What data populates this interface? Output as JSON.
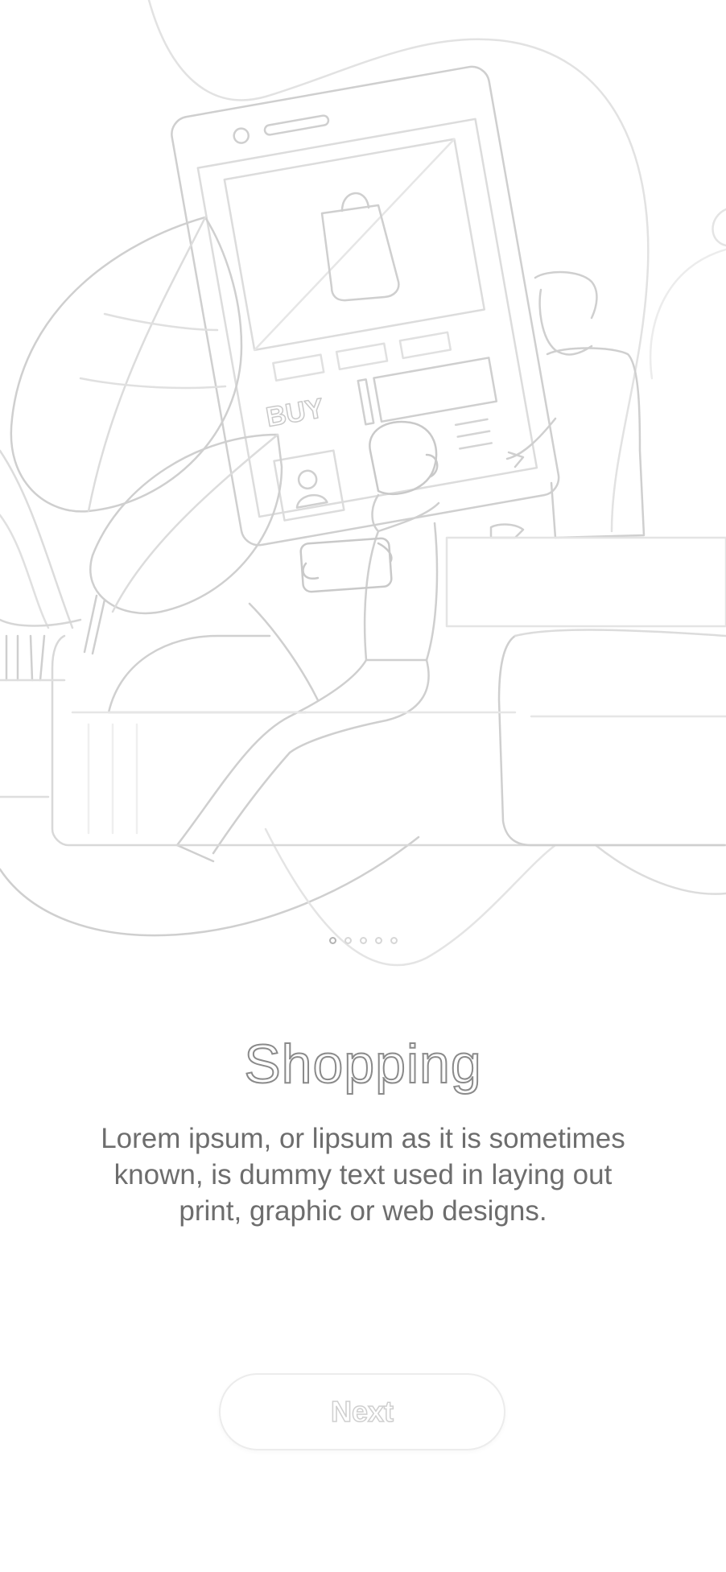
{
  "onboarding": {
    "illustration_text": "BUY",
    "title": "Shopping",
    "description": "Lorem ipsum, or lipsum as it is sometimes known, is dummy text used in laying out print, graphic or web designs.",
    "next_label": "Next",
    "pager": {
      "total": 5,
      "active_index": 0
    }
  },
  "colors": {
    "background": "#ffffff",
    "line_art": "#d4d4d4",
    "title_outline": "#8a8a8a",
    "description_text": "#6d6d6d",
    "button_border": "#ececec"
  }
}
